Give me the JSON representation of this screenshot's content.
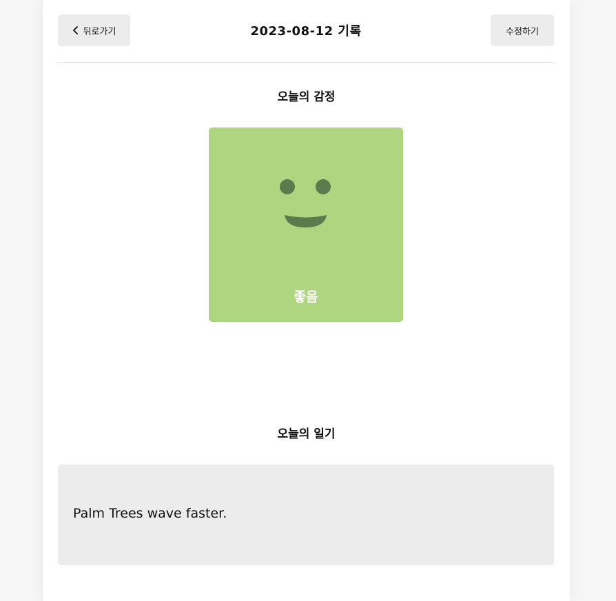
{
  "header": {
    "back_label": "뒤로가기",
    "title": "2023-08-12 기록",
    "edit_label": "수정하기"
  },
  "emotion": {
    "section_title": "오늘의 감정",
    "label": "좋음",
    "card_color": "#aed580",
    "face_color": "#5a7c4c",
    "icon": "smile-face-icon"
  },
  "diary": {
    "section_title": "오늘의 일기",
    "content": "Palm Trees wave faster."
  }
}
